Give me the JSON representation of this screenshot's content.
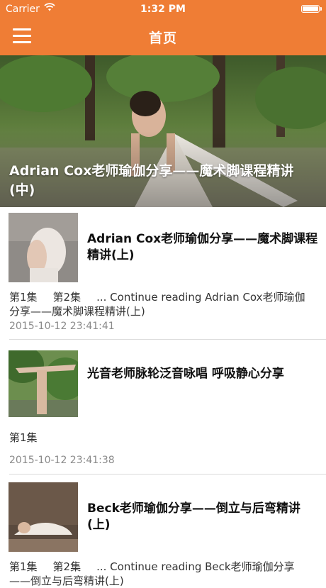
{
  "status_bar": {
    "carrier": "Carrier",
    "time": "1:32 PM"
  },
  "nav": {
    "title": "首页",
    "menu_icon": "hamburger-menu-icon"
  },
  "colors": {
    "accent": "#ef7d35",
    "date_text": "#8a8a8a",
    "divider": "#dcdcdc"
  },
  "hero": {
    "caption": "Adrian Cox老师瑜伽分享——魔术脚课程精讲(中)"
  },
  "articles": [
    {
      "title": "Adrian Cox老师瑜伽分享——魔术脚课程精讲(上)",
      "episodes": [
        "第1集",
        "第2集"
      ],
      "continue_text": "... Continue reading Adrian Cox老师瑜伽分享——魔术脚课程精讲(上)",
      "date": "2015-10-12 23:41:41"
    },
    {
      "title": "光音老师脉轮泛音咏唱 呼吸静心分享",
      "episodes": [
        "第1集"
      ],
      "continue_text": "",
      "date": "2015-10-12 23:41:38"
    },
    {
      "title": "Beck老师瑜伽分享——倒立与后弯精讲(上)",
      "episodes": [
        "第1集",
        "第2集"
      ],
      "continue_text": "... Continue reading Beck老师瑜伽分享——倒立与后弯精讲(上)",
      "date": ""
    }
  ]
}
